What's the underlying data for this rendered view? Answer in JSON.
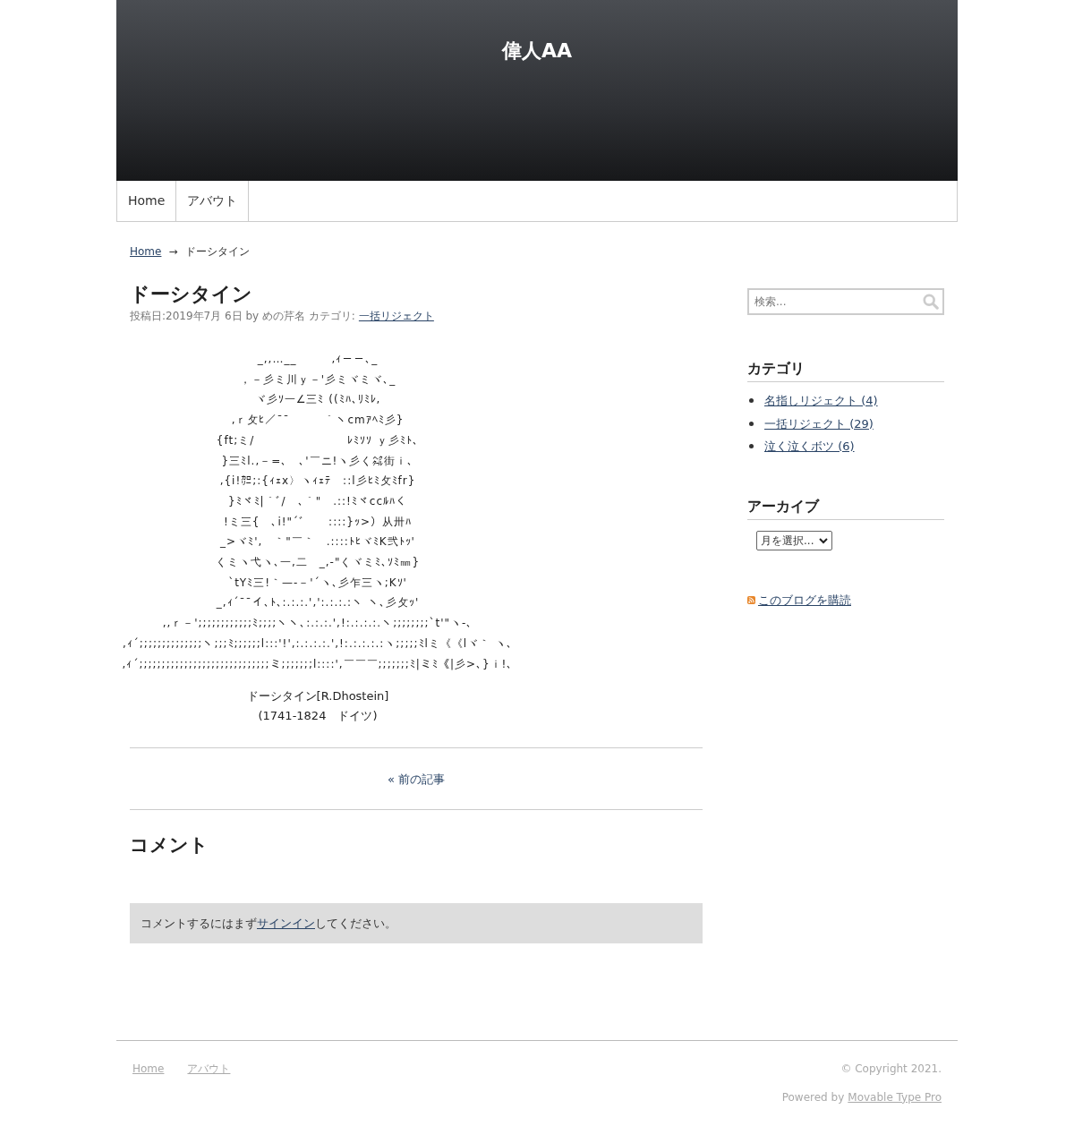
{
  "site_title": "偉人AA",
  "nav": [
    {
      "label": "Home",
      "selected": false
    },
    {
      "label": "アバウト",
      "selected": false
    }
  ],
  "breadcrumb": {
    "home": "Home",
    "separator": "→",
    "current": "ドーシタイン"
  },
  "article": {
    "title": "ドーシタイン",
    "meta_prefix": "投稿日:2019年7月 6日 by めの芹名 カテゴリ:",
    "category": "一括リジェクト",
    "art_lines": [
      "_,,…__　　　,ｨ－－､_",
      "，－彡ミ川ｙ－'彡ミヾミヾ､_",
      "ヾ彡ｿ一∠三ﾐ ((ﾐﾊ､ﾘﾐﾚ,",
      ",ｒ攵ﾋ／¯¯　　　｀ヽcmｱﾍﾐ彡}",
      "{ft;ミ/　　　　　　　　ﾚﾐｿｿ ｙ彡ﾐﾄ､",
      "}三ﾐl.,－=､　､'￣ニ!ヽ彡く㌶街ｉ､",
      ",{i!㌍;:{ｨｪx〉ヽｨｪﾃ　::l彡ﾋﾐ攵ﾐfr}",
      "}ﾐヾﾐ|｀ﾞ/　､｀\"　.::!ﾐヾccﾙﾊく",
      "!ミ三{　､i!\"´ﾞ　　::::}ｯ>）从卅ﾊ",
      "_>ヾﾐ',　｀\"￣｀　.::::ﾄﾋヾﾐK弐ﾄｯ'",
      "くミヽ弋ヽ､一,二　_,-\"くヾミﾐ､ｿﾐ㎜}",
      "`tYﾐ三!｀—-－'´ヽ､彡乍三ヽ;Kｿ'",
      "_,ｨ´¯¯イ､ﾄ､:.:.:.',':.:.:.:ヽ ヽ､彡攵ｯ'",
      ",,ｒ－';;;;;;;;;;;;ﾐ;;;;ヽヽ､:.:.:.',!:.:.:.:.ヽ;;;;;;;;`t'\"ヽ-､",
      ",ｨ´;;;;;;;;;;;;;;ヽ;;;ﾐ;;;;;;l:::'!',:.:.:.:.',!:.:.:.:.:ヽ;;;;;ﾐlミ《《lヾ｀ ヽ､",
      ",ｨ´;;;;;;;;;;;;;;;;;;;;;;;;;;;;;ミ;;;;;;;l::::',￣￣￣;;;;;;;ﾐ|ミﾐ《|彡>､}ｉ!､"
    ],
    "caption": [
      "ドーシタイン[R.Dhostein]",
      "(1741-1824　ドイツ)"
    ],
    "prev_link": "« 前の記事"
  },
  "comments": {
    "title": "コメント",
    "notice_before": "コメントするにはまず",
    "signin_link": "サインイン",
    "notice_after": "してください。"
  },
  "sidebar": {
    "search": {
      "placeholder": "検索..."
    },
    "categories_title": "カテゴリ",
    "categories": [
      {
        "label": "名指しリジェクト (4)"
      },
      {
        "label": "一括リジェクト (29)"
      },
      {
        "label": "泣く泣くボツ (6)"
      }
    ],
    "archive_title": "アーカイブ",
    "archive_select": "月を選択...",
    "subscribe": "このブログを購読"
  },
  "footer": {
    "links": [
      "Home",
      "アバウト"
    ],
    "copyright": "© Copyright 2021.",
    "powered_prefix": "Powered by",
    "powered_link": "Movable Type Pro"
  }
}
